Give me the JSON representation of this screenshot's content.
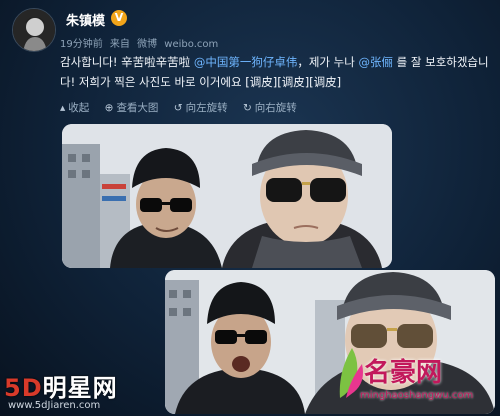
{
  "user": {
    "name": "朱镇模",
    "verified_badge": "V"
  },
  "meta": {
    "time": "19分钟前",
    "from": "来自",
    "source": "微博",
    "site": "weibo.com"
  },
  "post": {
    "text_a": "감사합니다! 辛苦啦辛苦啦 ",
    "mention_1": "@中国第一狗仔卓伟",
    "text_b": "，제가 ",
    "text_c": "누나",
    "text_d": " ",
    "mention_2": "@张俪",
    "text_e": " 를 잘 보호하겠습니다! 저희가 찍은 사진도 바로 이거에요 [调皮][调皮][调皮]"
  },
  "toolbar": {
    "collapse": "收起",
    "view_large": "查看大图",
    "rotate_left": "向左旋转",
    "rotate_right": "向右旋转"
  },
  "icons": {
    "collapse": "collapse-icon",
    "zoom": "zoom-icon",
    "rotate_left": "rotate-left-icon",
    "rotate_right": "rotate-right-icon"
  },
  "watermarks": {
    "left_brand_five": "5D",
    "left_brand_rest": "明星网",
    "left_url": "www.5dJiaren.com",
    "right_brand": "名豪网",
    "right_url": "minghaoshangwu.com"
  },
  "colors": {
    "mention": "#6fb6ff",
    "badge": "#f2a51a",
    "background": "#0c1d31"
  }
}
